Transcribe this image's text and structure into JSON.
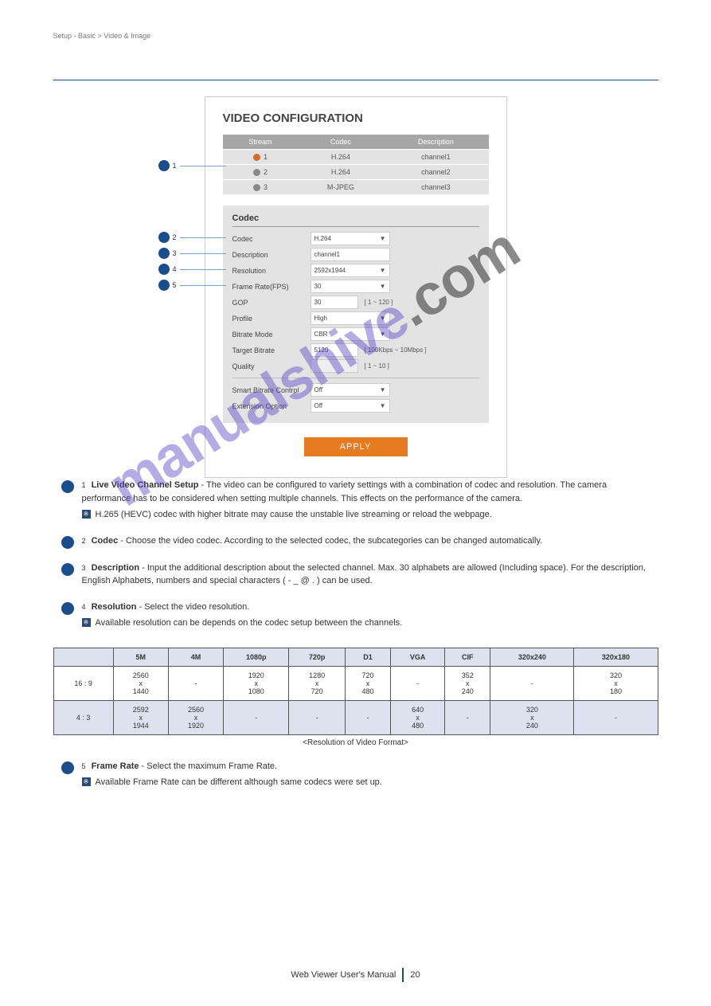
{
  "header": {
    "section": "Setup - Basic > Video & Image"
  },
  "panel": {
    "title": "VIDEO CONFIGURATION",
    "streams_header": {
      "c1": "Stream",
      "c2": "Codec",
      "c3": "Description"
    },
    "streams": [
      {
        "idx": "1",
        "codec": "H.264",
        "desc": "channel1",
        "selected": true
      },
      {
        "idx": "2",
        "codec": "H.264",
        "desc": "channel2",
        "selected": false
      },
      {
        "idx": "3",
        "codec": "M-JPEG",
        "desc": "channel3",
        "selected": false
      }
    ],
    "codec_title": "Codec",
    "rows": {
      "codec": {
        "label": "Codec",
        "value": "H.264"
      },
      "desc": {
        "label": "Description",
        "value": "channel1"
      },
      "res": {
        "label": "Resolution",
        "value": "2592x1944"
      },
      "fps": {
        "label": "Frame Rate(FPS)",
        "value": "30"
      },
      "gop": {
        "label": "GOP",
        "value": "30",
        "hint": "[ 1 ~ 120 ]"
      },
      "profile": {
        "label": "Profile",
        "value": "High"
      },
      "brmode": {
        "label": "Bitrate Mode",
        "value": "CBR"
      },
      "tbr": {
        "label": "Target Bitrate",
        "value": "5120",
        "hint": "[ 100Kbps ~ 10Mbps ]"
      },
      "quality": {
        "label": "Quality",
        "value": "",
        "hint": "[ 1 ~ 10 ]"
      },
      "sbc": {
        "label": "Smart Bitrate Control",
        "value": "Off"
      },
      "ext": {
        "label": "Extension Option",
        "value": "Off"
      }
    },
    "apply": "APPLY"
  },
  "callouts": {
    "n1": "1",
    "n2": "2",
    "n3": "3",
    "n4": "4",
    "n5": "5"
  },
  "expl": {
    "e1": {
      "label": "Live Video Channel Setup",
      "body": " - The video can be configured to variety settings with a combination of codec and resolution. The camera performance has to be considered when setting multiple channels. This effects on the performance of the camera.",
      "note": "H.265 (HEVC) codec with higher bitrate may cause the unstable live streaming or reload the webpage."
    },
    "e2": {
      "label": "Codec",
      "body": " - Choose the video codec. According to the selected codec, the subcategories can be changed automatically."
    },
    "e3": {
      "label": "Description",
      "body": " - Input the additional description about the selected channel. Max. 30 alphabets are allowed (Including space). For the description, English Alphabets, numbers and special characters ( - _ @ . ) can be used."
    },
    "e4": {
      "label": "Resolution",
      "body": " - Select the video resolution.",
      "note": "Available resolution can be depends on the codec setup between the channels."
    },
    "e5": {
      "label": "Frame Rate",
      "body": " - Select the maximum Frame Rate.",
      "note": "Available Frame Rate can be different although same codecs were set up."
    }
  },
  "res_table": {
    "header": [
      "5M",
      "4M",
      "1080p",
      "720p",
      "D1",
      "VGA",
      "CIF",
      "320x240",
      "320x180"
    ],
    "rows": [
      {
        "label": "16 : 9",
        "cells": [
          "2560\nx\n1440",
          "-",
          "1920\nx\n1080",
          "1280\nx\n720",
          "720\nx\n480",
          "-",
          "352\nx\n240",
          "-",
          "320\nx\n180"
        ]
      },
      {
        "label": "4 : 3",
        "cells": [
          "2592\nx\n1944",
          "2560\nx\n1920",
          "-",
          "-",
          "-",
          "640\nx\n480",
          "-",
          "320\nx\n240",
          "-"
        ]
      }
    ],
    "caption": "<Resolution of Video Format>"
  },
  "footer": {
    "left": "Web Viewer User's Manual",
    "right": "20"
  }
}
